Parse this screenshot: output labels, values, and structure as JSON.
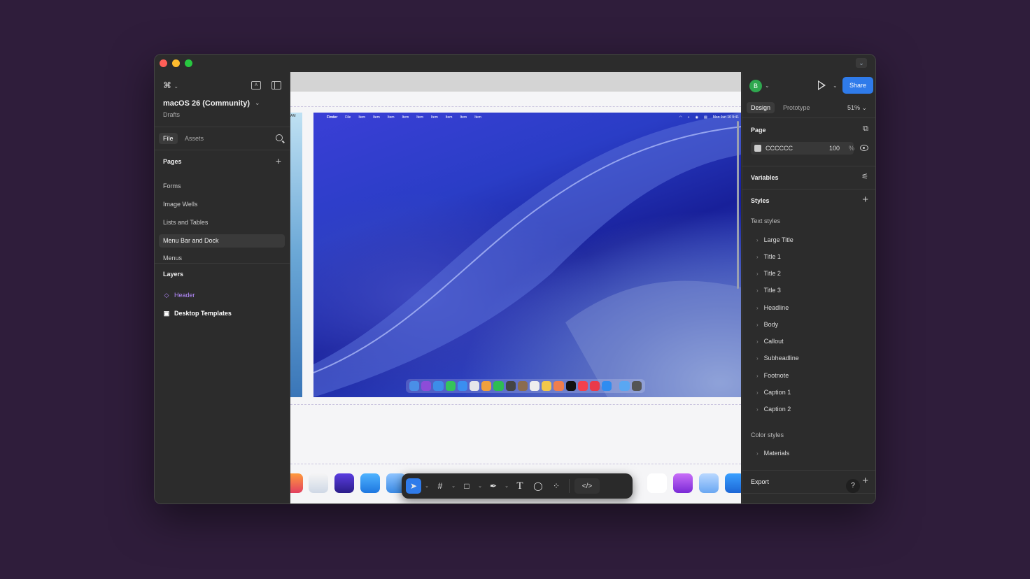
{
  "window": {
    "titlebar_chevron": "⌄"
  },
  "left_panel": {
    "file_title": "macOS 26 (Community)",
    "file_location": "Drafts",
    "tabs": [
      "File",
      "Assets"
    ],
    "pages_heading": "Pages",
    "pages": [
      "Forms",
      "Image Wells",
      "Lists and Tables",
      "Menu Bar and Dock",
      "Menus"
    ],
    "selected_page": "Menu Bar and Dock",
    "layers_heading": "Layers",
    "layers": [
      {
        "name": "Header",
        "icon": "component-icon",
        "color": "#b68bff"
      },
      {
        "name": "Desktop Templates",
        "icon": "frame-icon",
        "color": "#ffffff"
      }
    ]
  },
  "canvas": {
    "left_frame_label": "AM",
    "menubar": {
      "items": [
        "Finder",
        "File",
        "Item",
        "Item",
        "Item",
        "Item",
        "Item",
        "Item",
        "Item",
        "Item",
        "Item"
      ],
      "clock": "Mon Jun 10  9:41"
    }
  },
  "toolbar": {
    "tools": [
      "move-tool",
      "frame-tool",
      "shape-tool",
      "pen-tool",
      "text-tool",
      "comment-tool",
      "actions-tool",
      "dev-mode-tool"
    ]
  },
  "right_panel": {
    "avatar_initial": "B",
    "share_label": "Share",
    "tabs": [
      "Design",
      "Prototype"
    ],
    "zoom": "51%",
    "page_heading": "Page",
    "page_color": {
      "hex": "CCCCCC",
      "opacity": "100",
      "unit": "%"
    },
    "variables_heading": "Variables",
    "styles_heading": "Styles",
    "text_styles_label": "Text styles",
    "text_styles": [
      "Large Title",
      "Title 1",
      "Title 2",
      "Title 3",
      "Headline",
      "Body",
      "Callout",
      "Subheadline",
      "Footnote",
      "Caption 1",
      "Caption 2"
    ],
    "color_styles_label": "Color styles",
    "color_styles": [
      "Materials"
    ],
    "export_heading": "Export",
    "help_label": "?"
  },
  "colors": {
    "accent": "#2f7bea",
    "background": "#2f1d3b",
    "panel": "#2c2c2c"
  }
}
